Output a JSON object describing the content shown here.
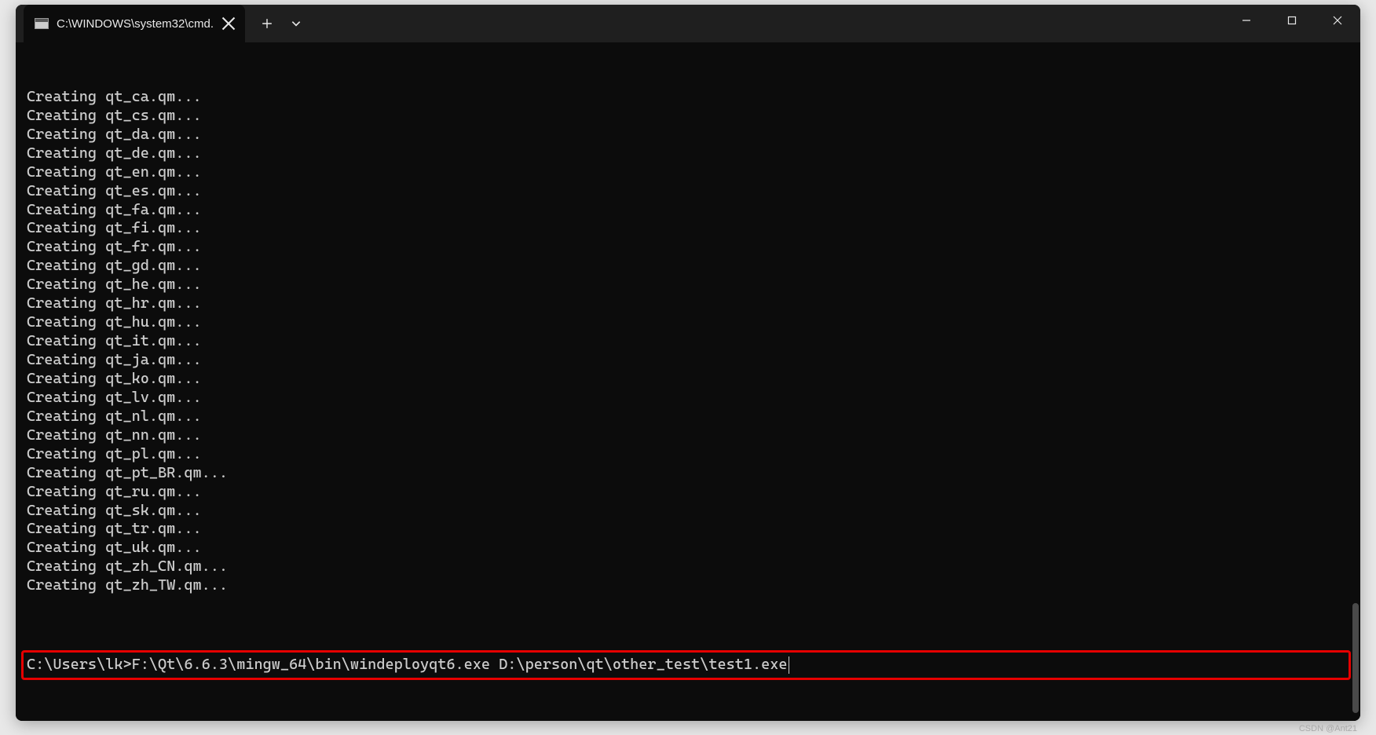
{
  "tab": {
    "title": "C:\\WINDOWS\\system32\\cmd."
  },
  "output_lines": [
    "Creating qt_ca.qm...",
    "Creating qt_cs.qm...",
    "Creating qt_da.qm...",
    "Creating qt_de.qm...",
    "Creating qt_en.qm...",
    "Creating qt_es.qm...",
    "Creating qt_fa.qm...",
    "Creating qt_fi.qm...",
    "Creating qt_fr.qm...",
    "Creating qt_gd.qm...",
    "Creating qt_he.qm...",
    "Creating qt_hr.qm...",
    "Creating qt_hu.qm...",
    "Creating qt_it.qm...",
    "Creating qt_ja.qm...",
    "Creating qt_ko.qm...",
    "Creating qt_lv.qm...",
    "Creating qt_nl.qm...",
    "Creating qt_nn.qm...",
    "Creating qt_pl.qm...",
    "Creating qt_pt_BR.qm...",
    "Creating qt_ru.qm...",
    "Creating qt_sk.qm...",
    "Creating qt_tr.qm...",
    "Creating qt_uk.qm...",
    "Creating qt_zh_CN.qm...",
    "Creating qt_zh_TW.qm..."
  ],
  "prompt": {
    "cwd": "C:\\Users\\lk>",
    "command": "F:\\Qt\\6.6.3\\mingw_64\\bin\\windeployqt6.exe D:\\person\\qt\\other_test\\test1.exe"
  },
  "watermark": "CSDN @Ant21"
}
